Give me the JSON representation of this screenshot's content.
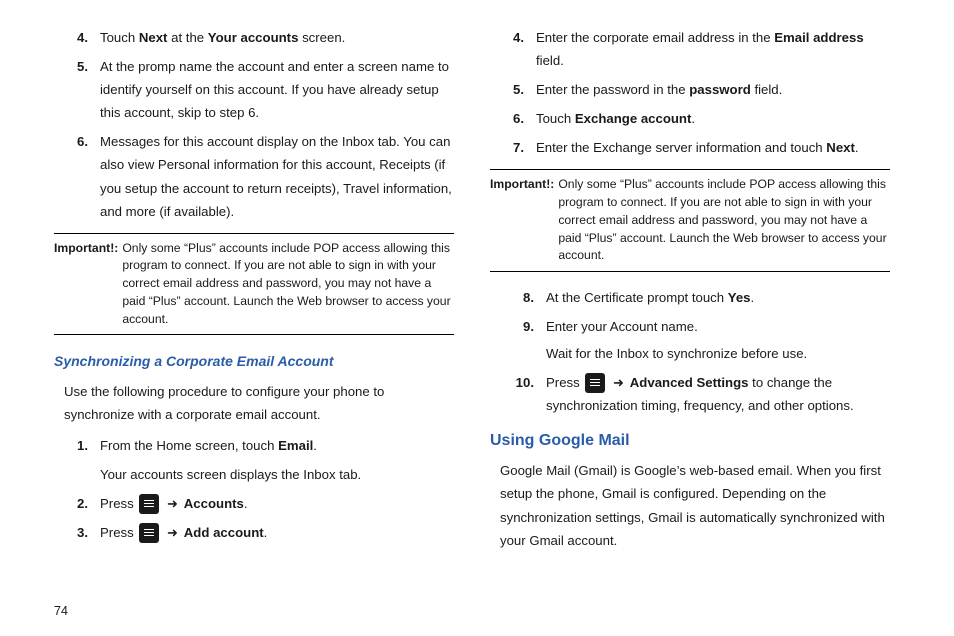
{
  "left": {
    "steps_a": [
      {
        "n": "4.",
        "html": "Touch <b>Next</b> at the <b>Your accounts</b> screen."
      },
      {
        "n": "5.",
        "html": "At the promp name the account and enter a screen name to identify yourself on this account. If you have already setup this account, skip to step 6."
      },
      {
        "n": "6.",
        "html": "Messages for this account display on the Inbox tab. You can also view Personal information for this account, Receipts (if you setup the account to return receipts), Travel information, and more (if available)."
      }
    ],
    "important_label": "Important!:",
    "important": "Only some “Plus” accounts include POP access allowing this program to connect. If you are not able to sign in with your correct email address and password, you may not have a paid “Plus” account. Launch the Web browser to access your account.",
    "sub_heading": "Synchronizing a Corporate Email Account",
    "intro": "Use the following procedure to configure your phone to synchronize with a corporate email account.",
    "steps_b": [
      {
        "n": "1.",
        "html": "From the Home screen, touch <b>Email</b>.<br><span style='display:block;margin-top:6px'>Your accounts screen displays the Inbox tab.</span>"
      },
      {
        "n": "2.",
        "html": "Press <span class='icon' data-name='menu-icon' data-interactable='false'></span> <span class='arrow'>➜</span> <b>Accounts</b>."
      },
      {
        "n": "3.",
        "html": "Press <span class='icon' data-name='menu-icon' data-interactable='false'></span> <span class='arrow'>➜</span> <b>Add account</b>."
      }
    ]
  },
  "right": {
    "steps_c": [
      {
        "n": "4.",
        "html": "Enter the corporate email address in the <b>Email address</b> field."
      },
      {
        "n": "5.",
        "html": "Enter the password in the <b>password</b> field."
      },
      {
        "n": "6.",
        "html": "Touch <b>Exchange account</b>."
      },
      {
        "n": "7.",
        "html": "Enter the Exchange server information and touch <b>Next</b>."
      }
    ],
    "important_label": "Important!:",
    "important": "Only some “Plus” accounts include POP access allowing this program to connect. If you are not able to sign in with your correct email address and password, you may not have a paid “Plus” account. Launch the Web browser to access your account.",
    "steps_d": [
      {
        "n": "8.",
        "html": "At the Certificate prompt touch <b>Yes</b>."
      },
      {
        "n": "9.",
        "html": "Enter your Account name.<br><span style='display:block;margin-top:4px'>Wait for the Inbox to synchronize before use.</span>"
      },
      {
        "n": "10.",
        "html": "Press <span class='icon' data-name='menu-icon' data-interactable='false'></span> <span class='arrow'>➜</span> <b>Advanced Settings</b> to change the synchronization timing, frequency, and other options."
      }
    ],
    "section_heading": "Using Google Mail",
    "section_body": "Google Mail (Gmail) is Google’s web-based email. When you first setup the phone, Gmail is configured. Depending on the synchronization settings, Gmail is automatically synchronized with your Gmail account."
  },
  "page_number": "74"
}
